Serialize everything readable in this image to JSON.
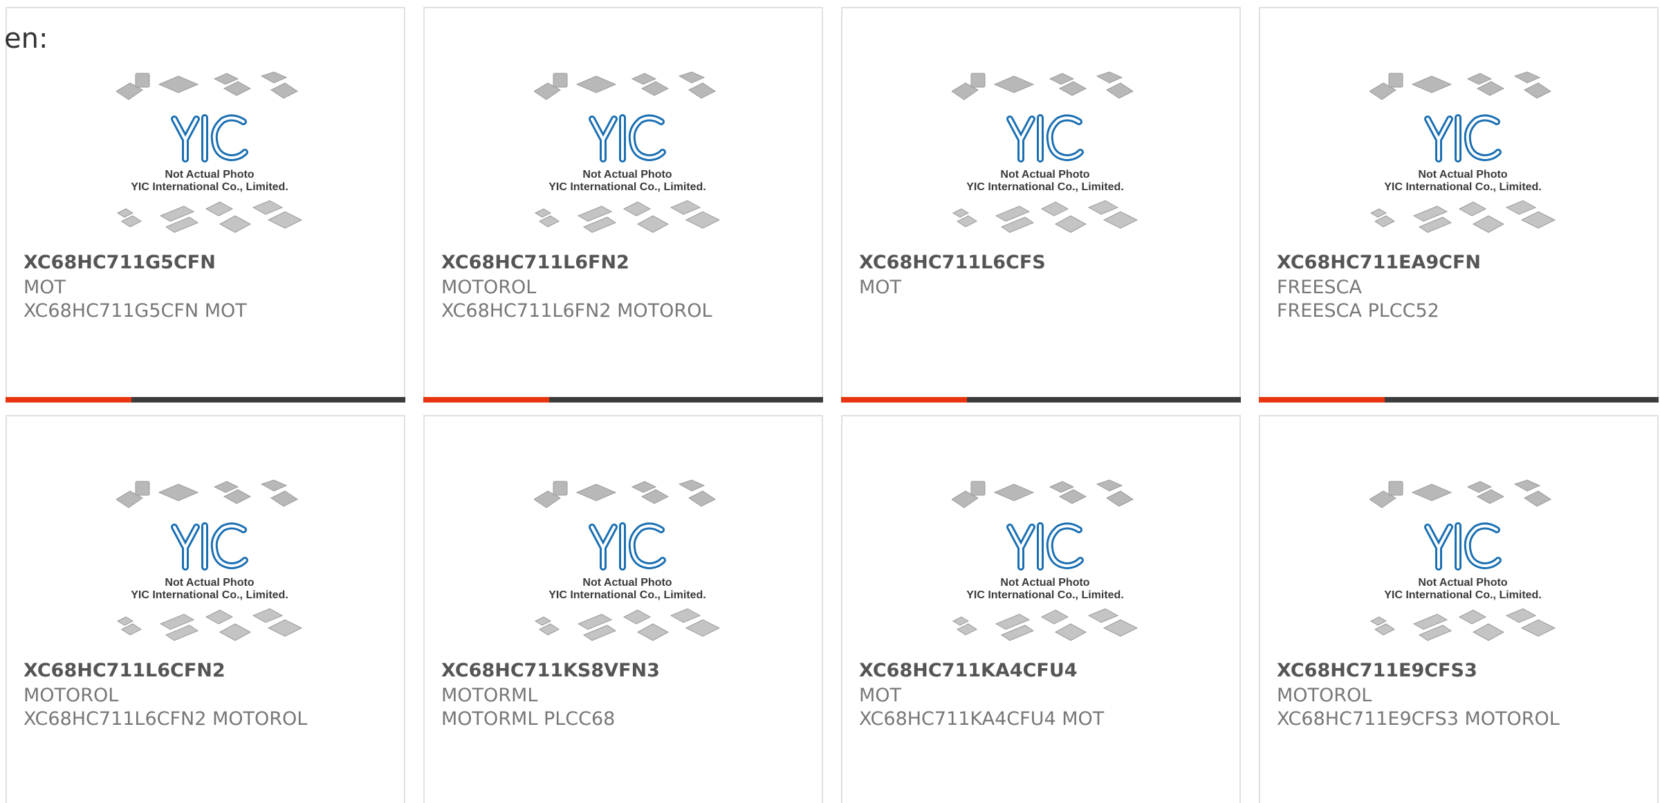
{
  "lang_label": "en:",
  "photo": {
    "logo_text": "YIC",
    "caption_line1": "Not Actual Photo",
    "caption_line2": "YIC International Co., Limited.",
    "logo_color": "#1a6fb3"
  },
  "colors": {
    "accent": "#e8350f",
    "bar": "#3c3c3c",
    "border": "#e0e0e0"
  },
  "products": [
    {
      "part": "XC68HC711G5CFN",
      "maker": "MOT",
      "desc": "XC68HC711G5CFN MOT"
    },
    {
      "part": "XC68HC711L6FN2",
      "maker": "MOTOROL",
      "desc": "XC68HC711L6FN2 MOTOROL"
    },
    {
      "part": "XC68HC711L6CFS",
      "maker": "MOT",
      "desc": ""
    },
    {
      "part": "XC68HC711EA9CFN",
      "maker": "FREESCA",
      "desc": "FREESCA PLCC52"
    },
    {
      "part": "XC68HC711L6CFN2",
      "maker": "MOTOROL",
      "desc": "XC68HC711L6CFN2 MOTOROL"
    },
    {
      "part": "XC68HC711KS8VFN3",
      "maker": "MOTORML",
      "desc": "MOTORML PLCC68"
    },
    {
      "part": "XC68HC711KA4CFU4",
      "maker": "MOT",
      "desc": "XC68HC711KA4CFU4 MOT"
    },
    {
      "part": "XC68HC711E9CFS3",
      "maker": "MOTOROL",
      "desc": "XC68HC711E9CFS3 MOTOROL"
    }
  ]
}
